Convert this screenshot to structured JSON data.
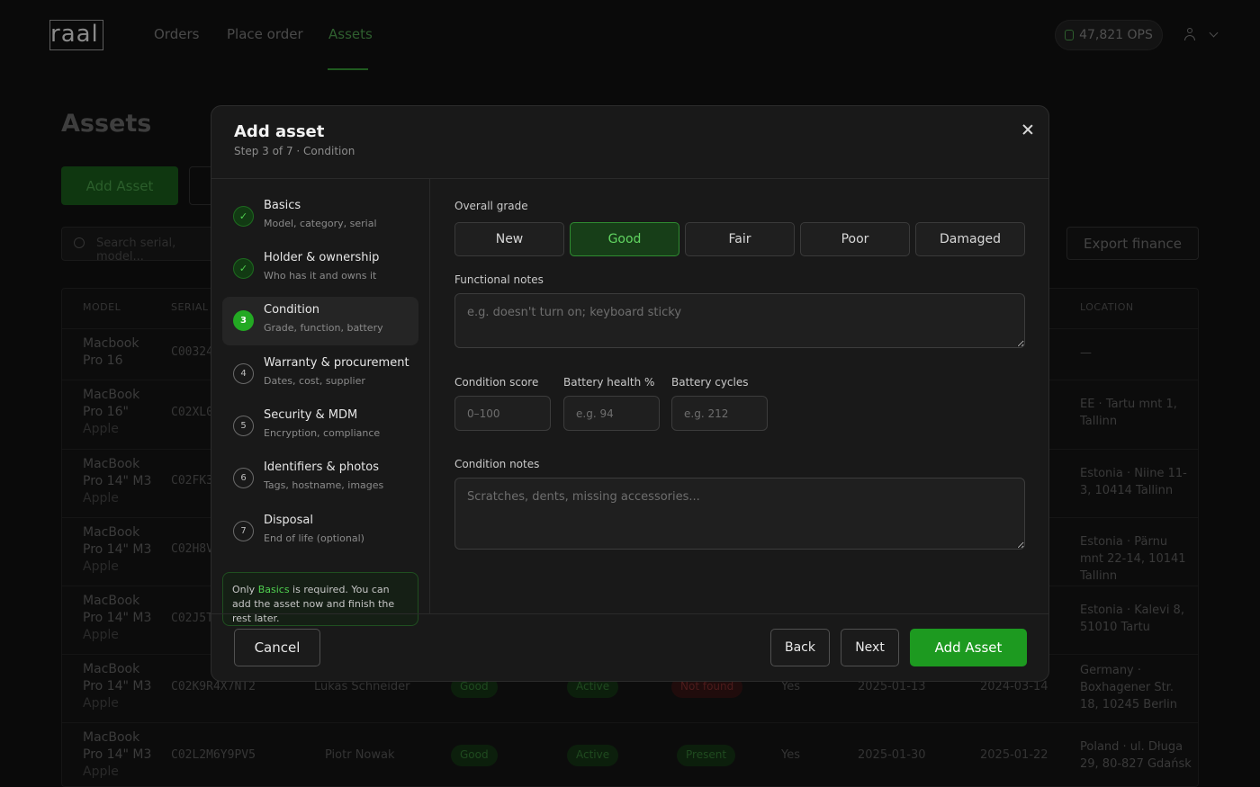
{
  "app": {
    "logo": "raal",
    "nav": [
      "Orders",
      "Place order",
      "Assets"
    ],
    "active_nav": "Assets",
    "ops_balance": "47,821 OPS"
  },
  "background": {
    "page_title": "Assets",
    "add_asset_label": "Add Asset",
    "search_placeholder": "Search serial, model...",
    "export_label": "Export finance",
    "headers": {
      "model": "MODEL",
      "serial": "SERIAL",
      "location": "LOCATION"
    },
    "rows": [
      {
        "model_line1": "Macbook",
        "model_line2": "Pro 16",
        "brand": "",
        "serial": "C00324",
        "location": "—"
      },
      {
        "model_line1": "MacBook",
        "model_line2": "Pro 16\"",
        "brand": "Apple",
        "serial": "C02XL0",
        "location": "EE · Tartu mnt 1, Tallinn"
      },
      {
        "model_line1": "MacBook",
        "model_line2": "Pro 14\" M3",
        "brand": "Apple",
        "serial": "C02FK3",
        "location": "Estonia · Niine 11-3, 10414 Tallinn"
      },
      {
        "model_line1": "MacBook",
        "model_line2": "Pro 14\" M3",
        "brand": "Apple",
        "serial": "C02H8V",
        "location": "Estonia · Pärnu mnt 22-14, 10141 Tallinn"
      },
      {
        "model_line1": "MacBook",
        "model_line2": "Pro 14\" M3",
        "brand": "Apple",
        "serial": "C02J5T",
        "location": "Estonia · Kalevi 8, 51010 Tartu"
      },
      {
        "model_line1": "MacBook",
        "model_line2": "Pro 14\" M3",
        "brand": "Apple",
        "serial": "C02K9R4X7NT2",
        "holder": "Lukas Schneider",
        "grade": "Good",
        "status": "Active",
        "presence": "Not found",
        "mdm": "Yes",
        "date1": "2025-01-13",
        "date2": "2024-03-14",
        "location": "Germany · Boxhagener Str. 18, 10245 Berlin"
      },
      {
        "model_line1": "MacBook",
        "model_line2": "Pro 14\" M3",
        "brand": "Apple",
        "serial": "C02L2M6Y9PV5",
        "holder": "Piotr Nowak",
        "grade": "Good",
        "status": "Active",
        "presence": "Present",
        "mdm": "Yes",
        "date1": "2025-01-30",
        "date2": "2025-01-22",
        "location": "Poland · ul. Długa 29, 80-827 Gdańsk"
      }
    ]
  },
  "modal": {
    "title": "Add asset",
    "subtitle": "Step 3 of 7 · Condition",
    "steps": [
      {
        "num": "1",
        "label": "Basics",
        "desc": "Model, category, serial",
        "state": "done"
      },
      {
        "num": "2",
        "label": "Holder & ownership",
        "desc": "Who has it and owns it",
        "state": "done"
      },
      {
        "num": "3",
        "label": "Condition",
        "desc": "Grade, function, battery",
        "state": "current"
      },
      {
        "num": "4",
        "label": "Warranty & procurement",
        "desc": "Dates, cost, supplier",
        "state": "todo"
      },
      {
        "num": "5",
        "label": "Security & MDM",
        "desc": "Encryption, compliance",
        "state": "todo"
      },
      {
        "num": "6",
        "label": "Identifiers & photos",
        "desc": "Tags, hostname, images",
        "state": "todo"
      },
      {
        "num": "7",
        "label": "Disposal",
        "desc": "End of life (optional)",
        "state": "todo"
      }
    ],
    "note": {
      "prefix": "Only ",
      "highlight": "Basics",
      "suffix": " is required. You can add the asset now and finish the rest later."
    },
    "grade_label": "Overall grade",
    "grades": [
      "New",
      "Good",
      "Fair",
      "Poor",
      "Damaged"
    ],
    "selected_grade": "Good",
    "functional_notes": {
      "label": "Functional notes",
      "placeholder": "e.g. doesn't turn on; keyboard sticky",
      "value": ""
    },
    "condition_score": {
      "label": "Condition score",
      "placeholder": "0–100",
      "value": ""
    },
    "battery_health": {
      "label": "Battery health %",
      "placeholder": "e.g. 94",
      "value": ""
    },
    "battery_cycles": {
      "label": "Battery cycles",
      "placeholder": "e.g. 212",
      "value": ""
    },
    "condition_notes": {
      "label": "Condition notes",
      "placeholder": "Scratches, dents, missing accessories...",
      "value": ""
    },
    "buttons": {
      "cancel": "Cancel",
      "back": "Back",
      "next": "Next",
      "add": "Add Asset"
    }
  },
  "colors": {
    "accent": "#1d9a20",
    "accent_text": "#61d561",
    "modal_bg": "#191919",
    "page_bg": "#0a0a0a"
  },
  "icons": {
    "close": "close-icon",
    "check": "check-icon",
    "user": "user-icon",
    "database": "database-icon",
    "search": "search-icon",
    "filter": "filter-icon"
  }
}
